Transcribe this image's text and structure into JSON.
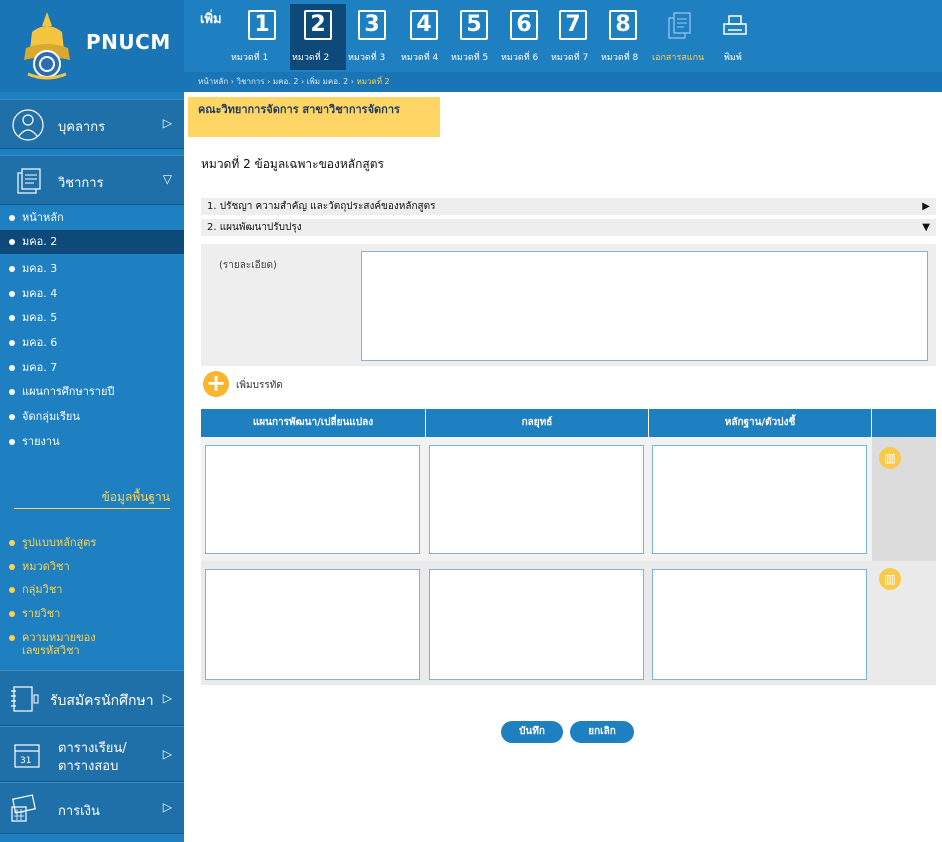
{
  "brand": "PNUCM",
  "topbar": {
    "add_label": "เพิ่ม",
    "chapters": [
      {
        "num": "1",
        "caption": "หมวดที่ 1"
      },
      {
        "num": "2",
        "caption": "หมวดที่ 2"
      },
      {
        "num": "3",
        "caption": "หมวดที่ 3"
      },
      {
        "num": "4",
        "caption": "หมวดที่ 4"
      },
      {
        "num": "5",
        "caption": "หมวดที่ 5"
      },
      {
        "num": "6",
        "caption": "หมวดที่ 6"
      },
      {
        "num": "7",
        "caption": "หมวดที่ 7"
      },
      {
        "num": "8",
        "caption": "หมวดที่ 8"
      }
    ],
    "scan_doc": "เอกสารสแกน",
    "print": "พิมพ์"
  },
  "breadcrumb": {
    "path": "หน้าหลัก › วิชาการ › มคอ. 2 › เพิ่ม มคอ. 2 › ",
    "current": "หมวดที่ 2"
  },
  "sidebar": {
    "personnel": "บุคลากร",
    "academic": "วิชาการ",
    "academic_items": [
      "หน้าหลัก",
      "มคอ. 2",
      "มคอ. 3",
      "มคอ. 4",
      "มคอ. 5",
      "มคอ. 6",
      "มคอ. 7",
      "แผนการศึกษารายปี",
      "จัดกลุ่มเรียน",
      "รายงาน"
    ],
    "base_title": "ข้อมูลพื้นฐาน",
    "base_items": [
      "รูปแบบหลักสูตร",
      "หมวดวิชา",
      "กลุ่มวิชา",
      "รายวิชา",
      "ความหมายของ",
      "เลขรหัสวิชา"
    ],
    "admission": "รับสมัครนักศึกษา",
    "schedule_1": "ตารางเรียน/",
    "schedule_2": "ตารางสอบ",
    "finance": "การเงิน",
    "arrow_right": "▷",
    "arrow_down": "▽"
  },
  "main": {
    "faculty": "คณะวิทยาการจัดการ สาขาวิชาการจัดการ",
    "section_title": "หมวดที่ 2 ข้อมูลเฉพาะของหลักสูตร",
    "acc1": "1. ปรัชญา ความสำคัญ และวัตถุประสงค์ของหลักสูตร",
    "acc2": "2. แผนพัฒนาปรับปรุง",
    "detail_label": "(รายละเอียด)",
    "add_row": "เพิ่มบรรทัด",
    "columns": [
      "แผนการพัฒนา/เปลี่ยนแปลง",
      "กลยุทธ์",
      "หลักฐาน/ตัวบ่งชี้"
    ],
    "save": "บันทึก",
    "cancel": "ยกเลิก"
  },
  "colors": {
    "primary": "#1e7fc1",
    "accent": "#f9b52d",
    "highlight": "#ffd666"
  }
}
